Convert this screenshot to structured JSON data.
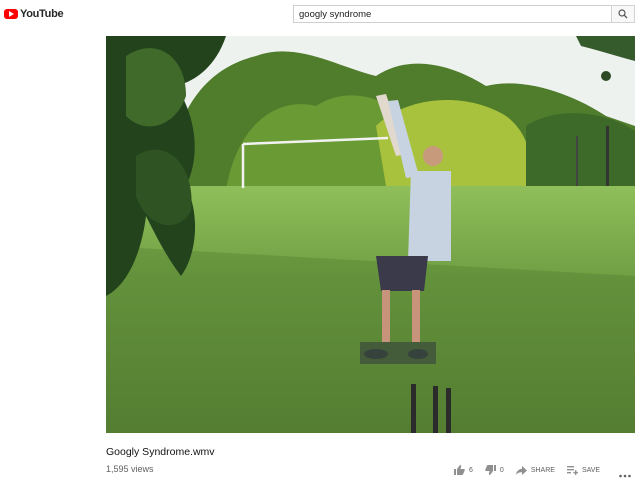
{
  "header": {
    "logo_text": "YouTube",
    "search_value": "googly syndrome",
    "search_icon": "search-icon"
  },
  "video": {
    "title": "Googly Syndrome.wmv",
    "views": "1,595 views"
  },
  "actions": {
    "like_count": "6",
    "dislike_count": "0",
    "share_label": "SHARE",
    "save_label": "SAVE"
  },
  "colors": {
    "brand": "#ff0000",
    "muted_text": "#606060",
    "icon": "#909090"
  }
}
